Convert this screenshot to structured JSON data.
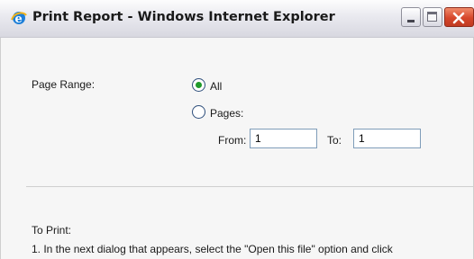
{
  "window": {
    "title": "Print Report - Windows Internet Explorer",
    "icon": "internet-explorer-icon"
  },
  "form": {
    "page_range_label": "Page Range:",
    "options": [
      {
        "label": "All",
        "selected": true
      },
      {
        "label": "Pages:",
        "selected": false
      }
    ],
    "from_label": "From:",
    "from_value": "1",
    "to_label": "To:",
    "to_value": "1"
  },
  "instructions": {
    "heading": "To Print:",
    "step1": "1. In the next dialog that appears, select the \"Open this file\" option and click"
  },
  "colors": {
    "radio_selected": "#1f9a2a",
    "close_button": "#d6472b"
  }
}
